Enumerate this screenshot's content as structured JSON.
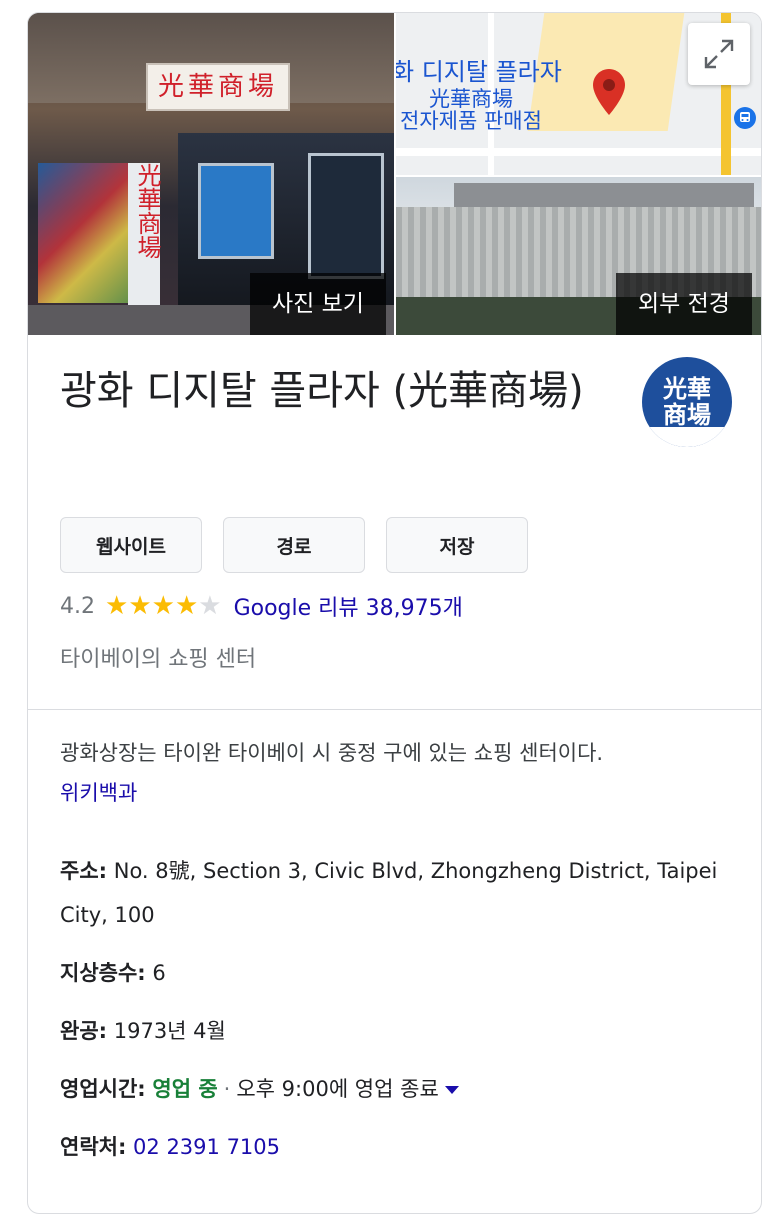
{
  "photos": {
    "view_photos_label": "사진 보기",
    "outside_label": "외부 전경",
    "sign_text": "光華商場",
    "column_text": "光華商場"
  },
  "map": {
    "label_ko": "화 디지탈 플라자",
    "label_zh": "光華商場",
    "label_sub": "전자제품 판매점",
    "expand_icon": "expand-icon",
    "bus_icon": "bus-icon",
    "pin_color": "#d93025"
  },
  "place": {
    "title": "광화 디지탈 플라자 (光華商場)",
    "logo_text_top": "光華",
    "logo_text_bottom": "商場"
  },
  "actions": {
    "website": "웹사이트",
    "directions": "경로",
    "save": "저장"
  },
  "rating": {
    "value": "4.2",
    "stars_filled": 4,
    "reviews": "Google 리뷰 38,975개"
  },
  "category": "타이베이의 쇼핑 센터",
  "description": {
    "text": "광화상장는 타이완 타이베이 시 중정 구에 있는 쇼핑 센터이다.",
    "source": "위키백과"
  },
  "facts": {
    "address_label": "주소:",
    "address_value": "No. 8號, Section 3, Civic Blvd, Zhongzheng District, Taipei City, 100",
    "floors_label": "지상층수:",
    "floors_value": "6",
    "completed_label": "완공:",
    "completed_value": "1973년 4월",
    "hours_label": "영업시간:",
    "hours_status": "영업 중",
    "hours_separator": "·",
    "hours_detail": "오후 9:00에 영업 종료",
    "phone_label": "연락처:",
    "phone_value": "02 2391 7105"
  },
  "colors": {
    "link": "#1a0dab",
    "open": "#188038",
    "star": "#fbbc04"
  }
}
